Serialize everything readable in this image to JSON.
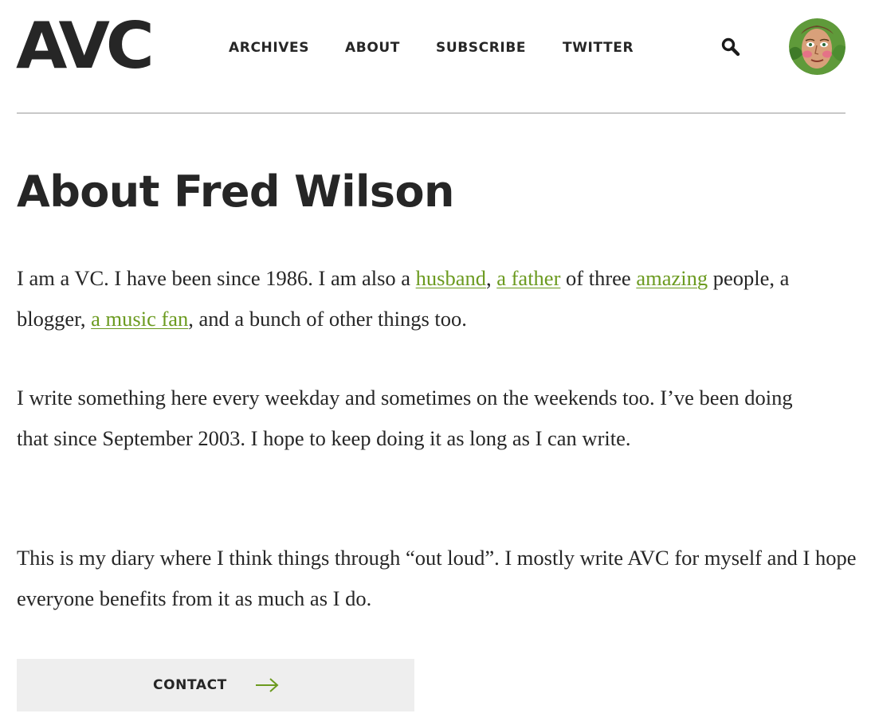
{
  "header": {
    "logo": "AVC",
    "nav": [
      {
        "label": "ARCHIVES"
      },
      {
        "label": "ABOUT"
      },
      {
        "label": "SUBSCRIBE"
      },
      {
        "label": "TWITTER"
      }
    ],
    "search_icon": "search-icon",
    "avatar_icon": "avatar"
  },
  "main": {
    "title": "About Fred Wilson",
    "p1": {
      "t1": "I am a VC. I have been since 1986. I am also a ",
      "link_husband": "husband",
      "t2": ", ",
      "link_father": "a father",
      "t3": " of three ",
      "link_amazing": "amazing",
      "t4": " people, a blogger, ",
      "link_music": "a music fan",
      "t5": ", and a bunch of other things too."
    },
    "p2": "I write something here every weekday and sometimes on the weekends too. I’ve been doing that since September 2003. I hope to keep doing it as long as I can write.",
    "p3": "This is my diary where I think things through “out loud”. I mostly write AVC for myself and I hope everyone benefits from it as much as I do.",
    "contact": {
      "label": "CONTACT",
      "icon": "arrow-right-icon"
    }
  },
  "colors": {
    "text": "#262626",
    "link": "#6b9a1f",
    "divider": "#c8c8c8",
    "button_bg": "#eeeeee"
  }
}
